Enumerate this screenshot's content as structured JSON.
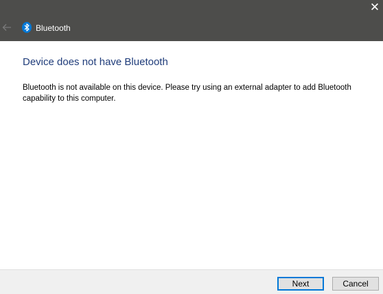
{
  "window": {
    "title": "Bluetooth",
    "close_glyph": "✕",
    "app_icon": "bluetooth-icon",
    "back_icon": "arrow-left-icon"
  },
  "main": {
    "heading": "Device does not have Bluetooth",
    "message": "Bluetooth is not available on this device. Please try using an external adapter to add Bluetooth capability to this computer."
  },
  "footer": {
    "next_label": "Next",
    "cancel_label": "Cancel"
  },
  "colors": {
    "titlebar": "#4d4d4b",
    "heading": "#1f3c7a",
    "bluetooth_blue": "#0078d7",
    "footer_bg": "#f0f0f0"
  }
}
